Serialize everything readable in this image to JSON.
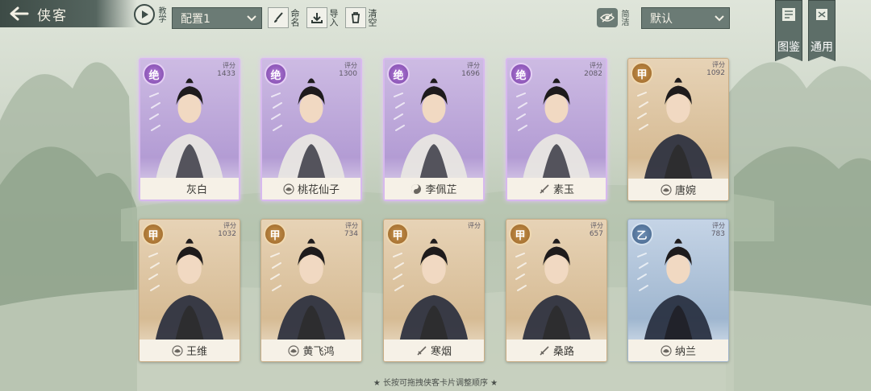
{
  "header": {
    "back_title": "侠客",
    "tutorial_label": "教学",
    "config_value": "配置1",
    "rename_label": "命名",
    "import_label": "导入",
    "clear_label": "清空",
    "filter_label": "简洁",
    "sort_value": "默认",
    "gallery_label": "图鉴",
    "general_label": "通用"
  },
  "score_label": "评分",
  "colors": {
    "grade_jue": "#8a56b8",
    "grade_jia": "#a8743a",
    "grade_yi": "#557aa3",
    "topbar": "#55655f"
  },
  "cards": [
    {
      "grade": "绝",
      "score": "1433",
      "name": "灰白",
      "sect_icon": "none",
      "tone": "jue"
    },
    {
      "grade": "绝",
      "score": "1300",
      "name": "桃花仙子",
      "sect_icon": "lotus-icon",
      "tone": "jue"
    },
    {
      "grade": "绝",
      "score": "1696",
      "name": "李佩芷",
      "sect_icon": "yin-yang-icon",
      "tone": "jue"
    },
    {
      "grade": "绝",
      "score": "2082",
      "name": "素玉",
      "sect_icon": "sword-icon",
      "tone": "jue"
    },
    {
      "grade": "甲",
      "score": "1092",
      "name": "唐婉",
      "sect_icon": "lotus-icon",
      "tone": "jia"
    },
    {
      "grade": "甲",
      "score": "1032",
      "name": "王维",
      "sect_icon": "lotus-icon",
      "tone": "jia"
    },
    {
      "grade": "甲",
      "score": "734",
      "name": "黄飞鸿",
      "sect_icon": "lotus-icon",
      "tone": "jia"
    },
    {
      "grade": "甲",
      "score": "",
      "name": "寒烟",
      "sect_icon": "sword-icon",
      "tone": "jia"
    },
    {
      "grade": "甲",
      "score": "657",
      "name": "桑路",
      "sect_icon": "sword-icon",
      "tone": "jia"
    },
    {
      "grade": "乙",
      "score": "783",
      "name": "纳兰",
      "sect_icon": "lotus-icon",
      "tone": "yi"
    }
  ],
  "footer_tip": "★ 长按可拖拽侠客卡片调整顺序 ★"
}
